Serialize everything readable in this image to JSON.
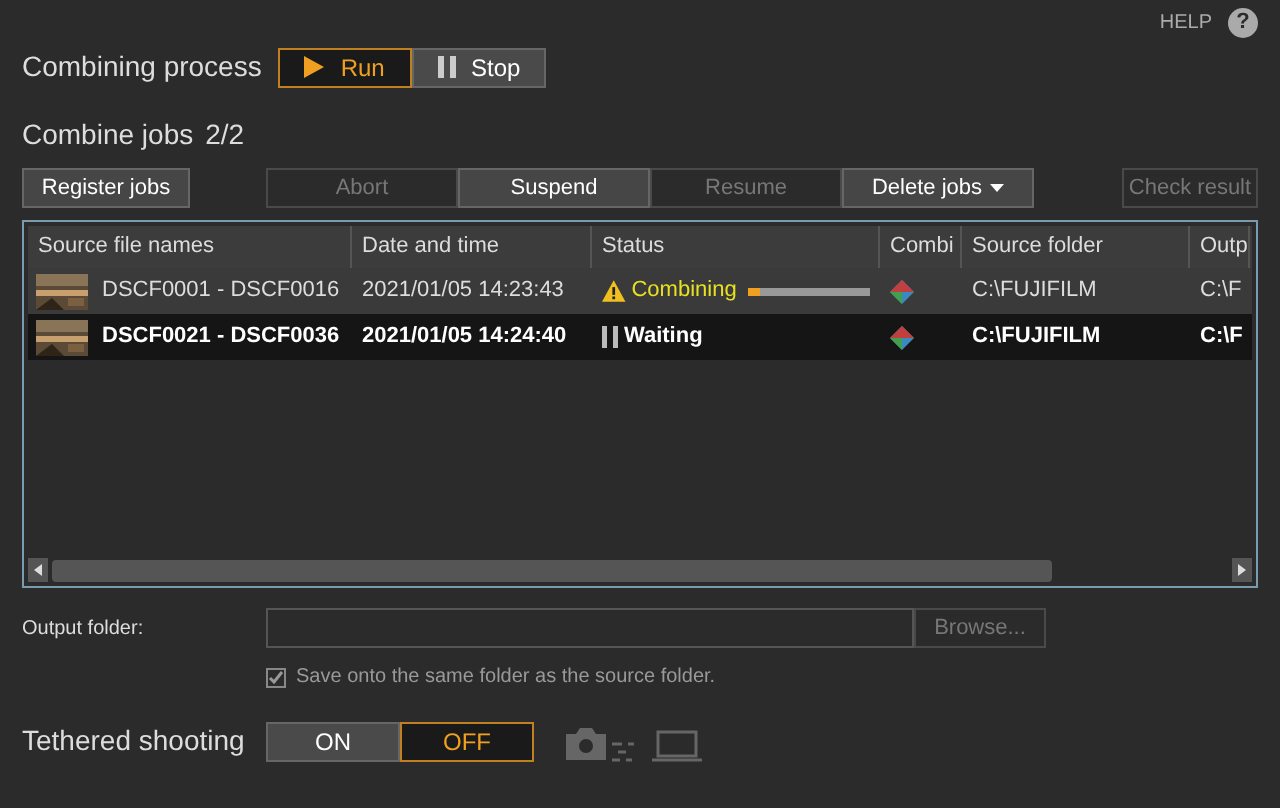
{
  "help": {
    "label": "HELP",
    "icon": "?"
  },
  "process": {
    "label": "Combining process",
    "options": [
      {
        "label": "Run",
        "kind": "play",
        "selected": true
      },
      {
        "label": "Stop",
        "kind": "pause",
        "selected": false
      }
    ]
  },
  "jobs": {
    "title": "Combine jobs",
    "count": "2/2"
  },
  "toolbar": {
    "register": {
      "label": "Register jobs",
      "disabled": false
    },
    "group": [
      {
        "label": "Abort",
        "disabled": true
      },
      {
        "label": "Suspend",
        "disabled": false
      },
      {
        "label": "Resume",
        "disabled": true
      },
      {
        "label": "Delete jobs",
        "disabled": false,
        "dropdown": true
      }
    ],
    "check": {
      "label": "Check result",
      "disabled": true
    }
  },
  "table": {
    "columns": [
      "Source file names",
      "Date and time",
      "Status",
      "Combi",
      "Source folder",
      "Outp"
    ],
    "rows": [
      {
        "name": "DSCF0001 - DSCF0016",
        "date": "2021/01/05 14:23:43",
        "status": {
          "kind": "combining",
          "label": "Combining",
          "level": 0.1
        },
        "source_folder": "C:\\FUJIFILM",
        "output_folder": "C:\\F",
        "selected": false
      },
      {
        "name": "DSCF0021 - DSCF0036",
        "date": "2021/01/05 14:24:40",
        "status": {
          "kind": "waiting",
          "label": "Waiting"
        },
        "source_folder": "C:\\FUJIFILM",
        "output_folder": "C:\\F",
        "selected": true
      }
    ]
  },
  "output": {
    "label": "Output folder:",
    "browse": {
      "label": "Browse...",
      "disabled": true
    },
    "same_folder": {
      "label": "Save onto the same folder as the source folder.",
      "checked": true,
      "disabled": true
    }
  },
  "tethered": {
    "label": "Tethered shooting",
    "options": [
      {
        "label": "ON",
        "selected": false
      },
      {
        "label": "OFF",
        "selected": true
      }
    ]
  }
}
